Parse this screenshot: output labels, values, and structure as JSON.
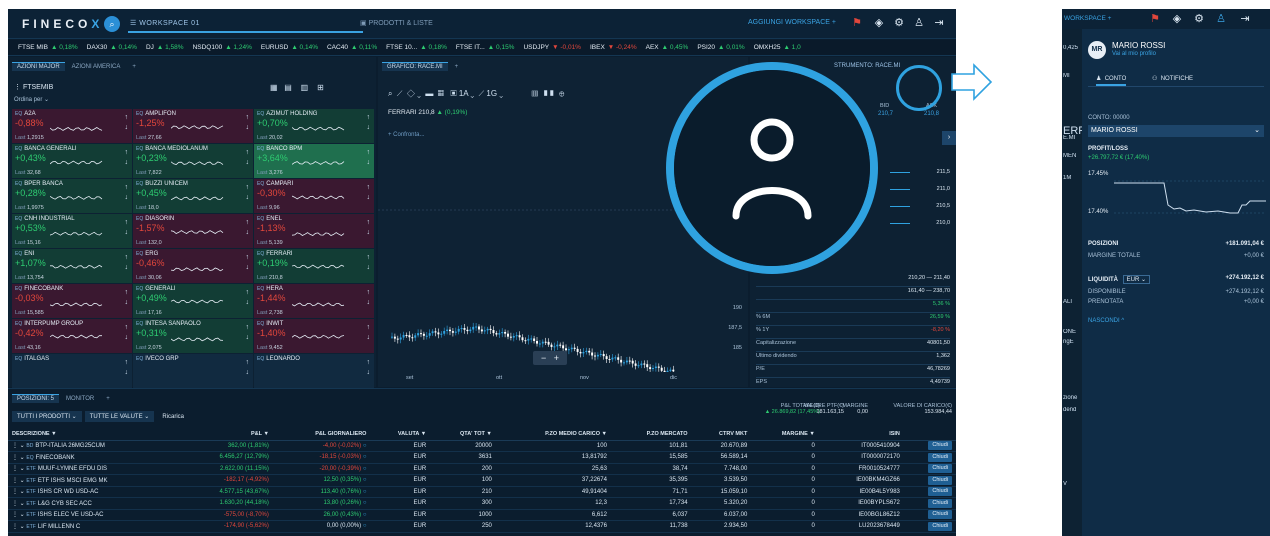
{
  "app": {
    "logo_text": "FINECO",
    "logo_x": "X",
    "workspace_tab": "WORKSPACE 01",
    "second_tab": "PRODOTTI & LISTE",
    "add_workspace": "AGGIUNGI WORKSPACE +"
  },
  "ticker": [
    {
      "name": "FTSE MIB",
      "change": "▲ 0,18%",
      "dir": "u"
    },
    {
      "name": "DAX30",
      "change": "▲ 0,14%",
      "dir": "u"
    },
    {
      "name": "DJ",
      "change": "▲ 1,58%",
      "dir": "u"
    },
    {
      "name": "NSDQ100",
      "change": "▲ 1,24%",
      "dir": "u"
    },
    {
      "name": "EURUSD",
      "change": "▲ 0,14%",
      "dir": "u"
    },
    {
      "name": "CAC40",
      "change": "▲ 0,11%",
      "dir": "u"
    },
    {
      "name": "FTSE 10...",
      "change": "▲ 0,18%",
      "dir": "u"
    },
    {
      "name": "FTSE IT...",
      "change": "▲ 0,15%",
      "dir": "u"
    },
    {
      "name": "USDJPY",
      "change": "▼ -0,01%",
      "dir": "d"
    },
    {
      "name": "IBEX",
      "change": "▼ -0,24%",
      "dir": "d"
    },
    {
      "name": "AEX",
      "change": "▲ 0,45%",
      "dir": "u"
    },
    {
      "name": "PSI20",
      "change": "▲ 0,01%",
      "dir": "u"
    },
    {
      "name": "OMXH25",
      "change": "▲ 1,0",
      "dir": "u"
    }
  ],
  "watchlist": {
    "tab1": "AZIONI MAJOR",
    "tab2": "AZIONI AMERICA",
    "list_name": "FTSEMIB",
    "order_label": "Ordina per",
    "tiles": [
      {
        "tag": "EQ",
        "name": "A2A",
        "pct": "-0,88%",
        "last": "1,2915",
        "tone": "red"
      },
      {
        "tag": "EQ",
        "name": "AMPLIFON",
        "pct": "-1,25%",
        "last": "27,66",
        "tone": "red"
      },
      {
        "tag": "EQ",
        "name": "AZIMUT HOLDING",
        "pct": "+0,70%",
        "last": "20,02",
        "tone": "green"
      },
      {
        "tag": "EQ",
        "name": "BANCA GENERALI",
        "pct": "+0,43%",
        "last": "32,68",
        "tone": "green"
      },
      {
        "tag": "EQ",
        "name": "BANCA MEDIOLANUM",
        "pct": "+0,23%",
        "last": "7,822",
        "tone": "green"
      },
      {
        "tag": "EQ",
        "name": "BANCO BPM",
        "pct": "+3,64%",
        "last": "3,276",
        "tone": "gbright"
      },
      {
        "tag": "EQ",
        "name": "BPER BANCA",
        "pct": "+0,28%",
        "last": "1,9975",
        "tone": "green"
      },
      {
        "tag": "EQ",
        "name": "BUZZI UNICEM",
        "pct": "+0,45%",
        "last": "18,0",
        "tone": "green"
      },
      {
        "tag": "EQ",
        "name": "CAMPARI",
        "pct": "-0,30%",
        "last": "9,96",
        "tone": "red"
      },
      {
        "tag": "EQ",
        "name": "CNH INDUSTRIAL",
        "pct": "+0,53%",
        "last": "15,16",
        "tone": "green"
      },
      {
        "tag": "EQ",
        "name": "DIASORIN",
        "pct": "-1,57%",
        "last": "132,0",
        "tone": "red"
      },
      {
        "tag": "EQ",
        "name": "ENEL",
        "pct": "-1,13%",
        "last": "5,139",
        "tone": "red"
      },
      {
        "tag": "EQ",
        "name": "ENI",
        "pct": "+1,07%",
        "last": "13,754",
        "tone": "green"
      },
      {
        "tag": "EQ",
        "name": "ERG",
        "pct": "-0,46%",
        "last": "30,06",
        "tone": "red"
      },
      {
        "tag": "EQ",
        "name": "FERRARI",
        "pct": "+0,19%",
        "last": "210,8",
        "tone": "green"
      },
      {
        "tag": "EQ",
        "name": "FINECOBANK",
        "pct": "-0,03%",
        "last": "15,585",
        "tone": "red"
      },
      {
        "tag": "EQ",
        "name": "GENERALI",
        "pct": "+0,49%",
        "last": "17,16",
        "tone": "green"
      },
      {
        "tag": "EQ",
        "name": "HERA",
        "pct": "-1,44%",
        "last": "2,738",
        "tone": "red"
      },
      {
        "tag": "EQ",
        "name": "INTERPUMP GROUP",
        "pct": "-0,42%",
        "last": "43,16",
        "tone": "red"
      },
      {
        "tag": "EQ",
        "name": "INTESA SANPAOLO",
        "pct": "+0,31%",
        "last": "2,075",
        "tone": "green"
      },
      {
        "tag": "EQ",
        "name": "INWIT",
        "pct": "-1,40%",
        "last": "9,452",
        "tone": "red"
      },
      {
        "tag": "EQ",
        "name": "ITALGAS",
        "pct": "",
        "last": "",
        "tone": "neutral"
      },
      {
        "tag": "EQ",
        "name": "IVECO GRP",
        "pct": "",
        "last": "",
        "tone": "neutral"
      },
      {
        "tag": "EQ",
        "name": "LEONARDO",
        "pct": "",
        "last": "",
        "tone": "neutral"
      }
    ]
  },
  "chart": {
    "tab": "GRAFICO: RACE.MI",
    "instrument": "FERRARI",
    "price": "210,8",
    "change": "▲ (0,19%)",
    "compare": "+ Confronta...",
    "interval": "1A",
    "y_ticks": [
      "190",
      "187,5",
      "185"
    ],
    "x_ticks": [
      "set",
      "ott",
      "nov",
      "dic"
    ],
    "zoom_minus": "−",
    "zoom_plus": "+"
  },
  "info_panel": {
    "tab": "STRUMENTO: RACE.MI",
    "bid_label": "BID",
    "ask_label": "ASK",
    "bid": "210,7",
    "ask": "210,8",
    "book_levels": [
      "211,5",
      "211,0",
      "210,5",
      "210,0"
    ],
    "rows": [
      {
        "label": "",
        "value": "210,20  —  211,40",
        "tone": ""
      },
      {
        "label": "",
        "value": "161,40  —  238,70",
        "tone": ""
      },
      {
        "label": "",
        "value": "5,36 %",
        "tone": "g"
      },
      {
        "label": "% 6M",
        "value": "26,59 %",
        "tone": "g"
      },
      {
        "label": "% 1Y",
        "value": "-8,20 %",
        "tone": "r"
      },
      {
        "label": "Capitalizzazione",
        "value": "40801,50",
        "tone": ""
      },
      {
        "label": "Ultimo dividendo",
        "value": "1,362",
        "tone": ""
      },
      {
        "label": "P/E",
        "value": "46,78269",
        "tone": ""
      },
      {
        "label": "EPS",
        "value": "4,49739",
        "tone": ""
      }
    ]
  },
  "positions": {
    "tab1": "POSIZIONI: 5",
    "tab2": "MONITOR",
    "filter1": "TUTTI I PRODOTTI",
    "filter2": "TUTTE LE VALUTE",
    "refresh": "Ricarica",
    "totals": {
      "pl_label": "P&L TOTALE(€)",
      "pl_value": "▲ 26.869,82 (17,45%)",
      "ptf_label": "VALORE PTF(€)",
      "ptf_value": "181.163,15",
      "margin_label": "MARGINE",
      "margin_value": "0,00",
      "cash_label": "VALORE DI CARICO(€)",
      "cash_value": "153.984,44"
    },
    "columns": [
      "DESCRIZIONE ▼",
      "P&L ▼",
      "P&L GIORNALIERO",
      "VALUTA ▼",
      "QTA' TOT ▼",
      "P.ZO MEDIO CARICO ▼",
      "P.ZO MERCATO",
      "CTRV MKT",
      "MARGINE ▼",
      "ISIN",
      ""
    ],
    "rows": [
      {
        "tag": "BD",
        "desc": "BTP-ITALIA 26MG25CUM",
        "pl": "362,00 (1,81%)",
        "plt": "g",
        "pld": "-4,00 (-0,02%)",
        "pldt": "r",
        "cur": "EUR",
        "qty": "20000",
        "avg": "100",
        "mkt": "101,81",
        "ctrv": "20.670,89",
        "marg": "0",
        "isin": "IT0005410904"
      },
      {
        "tag": "EQ",
        "desc": "FINECOBANK",
        "pl": "6.456,27 (12,79%)",
        "plt": "g",
        "pld": "-18,15 (-0,03%)",
        "pldt": "r",
        "cur": "EUR",
        "qty": "3631",
        "avg": "13,81792",
        "mkt": "15,585",
        "ctrv": "56.589,14",
        "marg": "0",
        "isin": "IT0000072170"
      },
      {
        "tag": "ETF",
        "desc": "MUUF-LYMNE EFDU DIS",
        "pl": "2.622,00 (11,15%)",
        "plt": "g",
        "pld": "-20,00 (-0,39%)",
        "pldt": "r",
        "cur": "EUR",
        "qty": "200",
        "avg": "25,63",
        "mkt": "38,74",
        "ctrv": "7.748,00",
        "marg": "0",
        "isin": "FR0010524777"
      },
      {
        "tag": "ETF",
        "desc": "ETF ISHS MSCI EMG MK",
        "pl": "-182,17 (-4,92%)",
        "plt": "r",
        "pld": "12,50 (0,35%)",
        "pldt": "g",
        "cur": "EUR",
        "qty": "100",
        "avg": "37,22674",
        "mkt": "35,395",
        "ctrv": "3.539,50",
        "marg": "0",
        "isin": "IE00BKM4GZ66"
      },
      {
        "tag": "ETF",
        "desc": "ISHS CR WD USD-AC",
        "pl": "4.577,15 (43,67%)",
        "plt": "g",
        "pld": "113,40 (0,76%)",
        "pldt": "g",
        "cur": "EUR",
        "qty": "210",
        "avg": "49,91404",
        "mkt": "71,71",
        "ctrv": "15.059,10",
        "marg": "0",
        "isin": "IE00B4L5Y983"
      },
      {
        "tag": "ETF",
        "desc": "L&G CYB SEC ACC",
        "pl": "1.630,20 (44,18%)",
        "plt": "g",
        "pld": "13,80 (0,26%)",
        "pldt": "g",
        "cur": "EUR",
        "qty": "300",
        "avg": "12,3",
        "mkt": "17,734",
        "ctrv": "5.320,20",
        "marg": "0",
        "isin": "IE00BYPLS672"
      },
      {
        "tag": "ETF",
        "desc": "ISHS ELEC VE USD-AC",
        "pl": "-575,00 (-8,70%)",
        "plt": "r",
        "pld": "26,00 (0,43%)",
        "pldt": "g",
        "cur": "EUR",
        "qty": "1000",
        "avg": "6,612",
        "mkt": "6,037",
        "ctrv": "6.037,00",
        "marg": "0",
        "isin": "IE00BGL86Z12"
      },
      {
        "tag": "ETF",
        "desc": "LIF MILLENN C",
        "pl": "-174,90 (-5,62%)",
        "plt": "r",
        "pld": "0,00 (0,00%)",
        "pldt": "",
        "cur": "EUR",
        "qty": "250",
        "avg": "12,4376",
        "mkt": "11,738",
        "ctrv": "2.934,50",
        "marg": "0",
        "isin": "LU2023678449"
      }
    ],
    "close_label": "Chiudi"
  },
  "profile_drawer": {
    "workspace": "WORKSPACE +",
    "initials": "MR",
    "name": "MARIO ROSSI",
    "profile_link": "Vai al mio profilo",
    "tab_account": "CONTO",
    "tab_notifications": "NOTIFICHE",
    "account_label": "CONTO: 00000",
    "account_value": "MARIO ROSSI",
    "profit_label": "PROFIT/LOSS",
    "profit_value": "+26.797,72 € (17,40%)",
    "spark_hi": "17.45%",
    "spark_lo": "17.40%",
    "positions_label": "POSIZIONI",
    "positions_value": "+181.091,04 €",
    "margin_label": "MARGINE TOTALE",
    "margin_value": "+0,00 €",
    "liquidity_label": "LIQUIDITÀ",
    "liquidity_currency": "EUR",
    "liquidity_value": "+274.192,12 €",
    "available_label": "DISPONIBILE",
    "available_value": "+274.192,12 €",
    "booked_label": "PRENOTATA",
    "booked_value": "+0,00 €",
    "hide_label": "NASCONDI ^",
    "peek_texts": [
      "0,425",
      "MI",
      "ERR",
      "E.MI",
      "MEN",
      "1M",
      "ALI",
      "ONE",
      "ngE",
      "zione",
      "dend",
      "V"
    ]
  },
  "colors": {
    "accent": "#2fa2e0",
    "up": "#2ecc71",
    "down": "#e2473c",
    "bg": "#0b1d2e"
  }
}
